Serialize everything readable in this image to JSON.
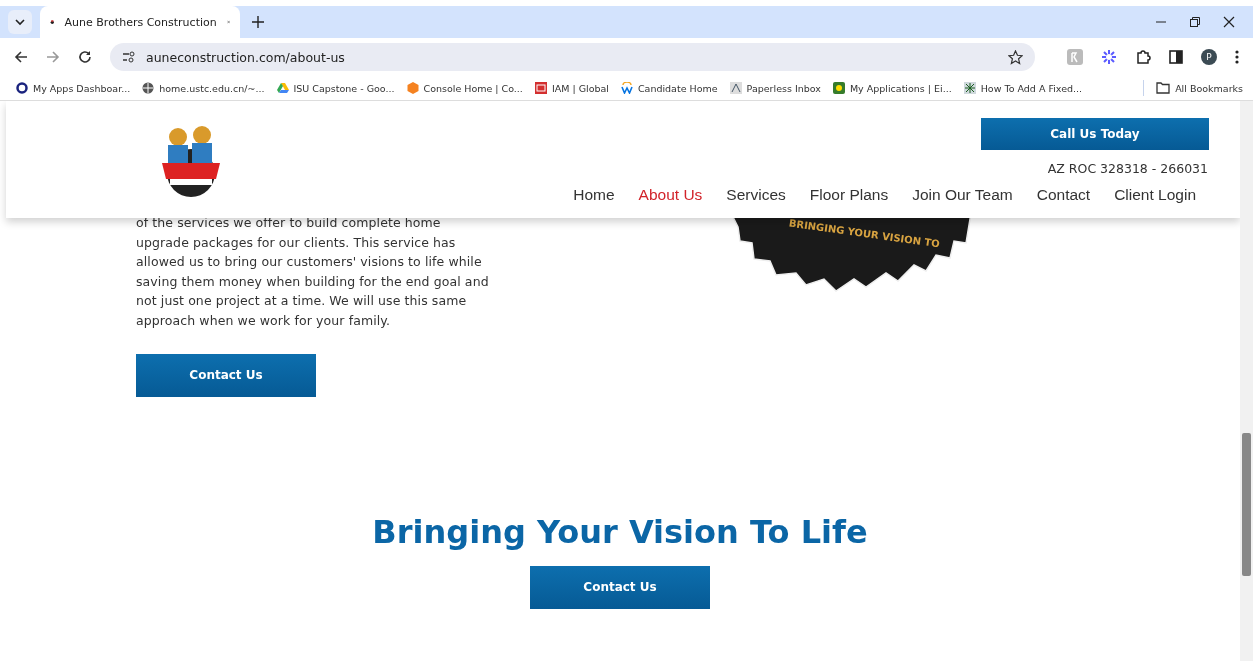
{
  "browser": {
    "tab_title": "Aune Brothers Construction",
    "url": "auneconstruction.com/about-us",
    "profile_initial": "P",
    "bookmarks": [
      {
        "label": "My Apps Dashboar..."
      },
      {
        "label": "home.ustc.edu.cn/~..."
      },
      {
        "label": "ISU Capstone - Goo..."
      },
      {
        "label": "Console Home | Co..."
      },
      {
        "label": "IAM | Global"
      },
      {
        "label": "Candidate Home"
      },
      {
        "label": "Paperless Inbox"
      },
      {
        "label": "My Applications | Ei..."
      },
      {
        "label": "How To Add A Fixed..."
      }
    ],
    "all_bookmarks": "All Bookmarks"
  },
  "header": {
    "call_button": "Call Us Today",
    "license": "AZ ROC 328318 - 266031",
    "nav": [
      {
        "label": "Home",
        "selected": false
      },
      {
        "label": "About Us",
        "selected": true
      },
      {
        "label": "Services",
        "selected": false
      },
      {
        "label": "Floor Plans",
        "selected": false
      },
      {
        "label": "Join Our Team",
        "selected": false
      },
      {
        "label": "Contact",
        "selected": false
      },
      {
        "label": "Client Login",
        "selected": false
      }
    ]
  },
  "about": {
    "paragraph": "of the services we offer to build complete home upgrade packages for our clients.  This service has allowed us to bring our customers' visions to life while saving them money when building for the end goal and not just one project at a time.  We will use this same approach when we work for your family.",
    "button": "Contact Us",
    "logo_caption": "BRINGING YOUR VISION TO"
  },
  "cta": {
    "heading": "Bringing Your Vision To Life",
    "button": "Contact Us"
  }
}
